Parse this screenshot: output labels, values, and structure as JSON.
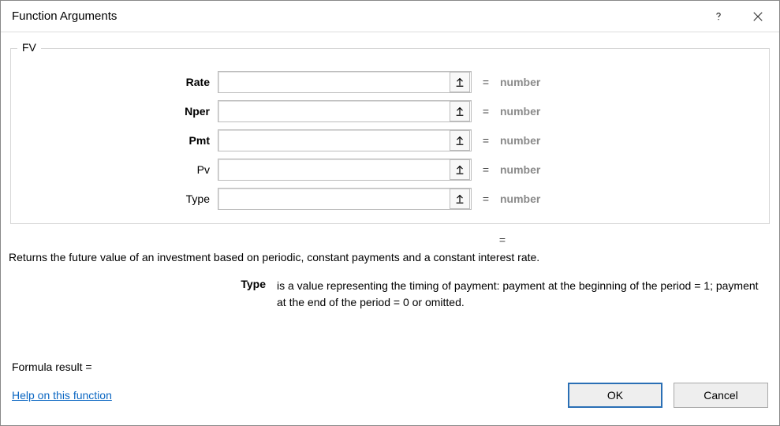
{
  "titlebar": {
    "title": "Function Arguments"
  },
  "function": {
    "name": "FV",
    "description": "Returns the future value of an investment based on periodic, constant payments and a constant interest rate."
  },
  "args": [
    {
      "label": "Rate",
      "bold": true,
      "value": "",
      "result": "number"
    },
    {
      "label": "Nper",
      "bold": true,
      "value": "",
      "result": "number"
    },
    {
      "label": "Pmt",
      "bold": true,
      "value": "",
      "result": "number"
    },
    {
      "label": "Pv",
      "bold": false,
      "value": "",
      "result": "number"
    },
    {
      "label": "Type",
      "bold": false,
      "value": "",
      "result": "number"
    }
  ],
  "overall_result": "",
  "arg_help": {
    "label": "Type",
    "text": "is a value representing the timing of payment: payment at the beginning of the period = 1; payment at the end of the period = 0 or omitted."
  },
  "formula_result_label": "Formula result =",
  "formula_result_value": "",
  "footer": {
    "help_link": "Help on this function",
    "ok": "OK",
    "cancel": "Cancel"
  },
  "symbols": {
    "equals": "="
  }
}
